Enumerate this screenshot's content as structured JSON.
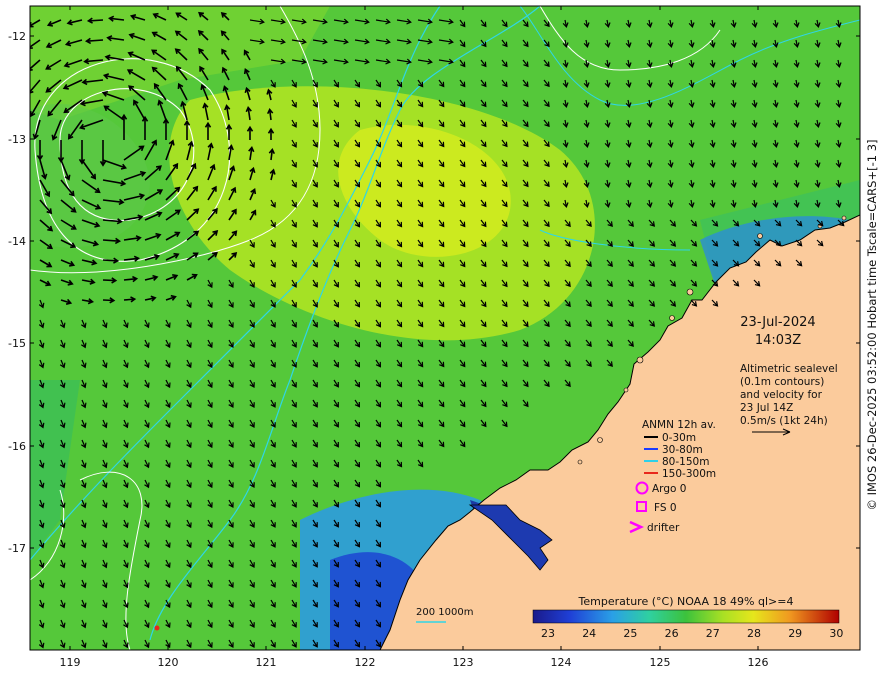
{
  "header": {
    "date": "23-Jul-2024",
    "time": "14:03Z"
  },
  "description": {
    "line1": "Altimetric sealevel",
    "line2": "(0.1m contours)",
    "line3": "and velocity for",
    "line4": "23 Jul 14Z",
    "line5": "0.5m/s (1kt 24h)"
  },
  "legend": {
    "title": "ANMN 12h av.",
    "items": [
      {
        "label": "0-30m",
        "color": "#000000"
      },
      {
        "label": "30-80m",
        "color": "#1a3cff"
      },
      {
        "label": "80-150m",
        "color": "#2fd0e8"
      },
      {
        "label": "150-300m",
        "color": "#e8281c"
      }
    ],
    "argo": "Argo 0",
    "fs": "FS 0",
    "drifter": "drifter",
    "marker_color": "#ff00ff"
  },
  "bathymetry_label": "200  1000m",
  "colorbar": {
    "title": "Temperature (°C) NOAA 18 49% ql>=4",
    "ticks": [
      "23",
      "24",
      "25",
      "26",
      "27",
      "28",
      "29",
      "30"
    ]
  },
  "credit": "© IMOS 26-Dec-2025 03:52:00 Hobart time Tscale=CARS+[-1 3]",
  "axes": {
    "x_ticks": [
      "119",
      "120",
      "121",
      "122",
      "123",
      "124",
      "125",
      "126"
    ],
    "y_ticks": [
      "-12",
      "-13",
      "-14",
      "-15",
      "-16",
      "-17"
    ]
  },
  "colors": {
    "land": "#fbcb9c",
    "ocean_warm": "#8ee02a",
    "ocean_mid": "#3cc23c",
    "ocean_cool": "#1a6fd1",
    "contour_cyan": "#2fd6e6"
  }
}
